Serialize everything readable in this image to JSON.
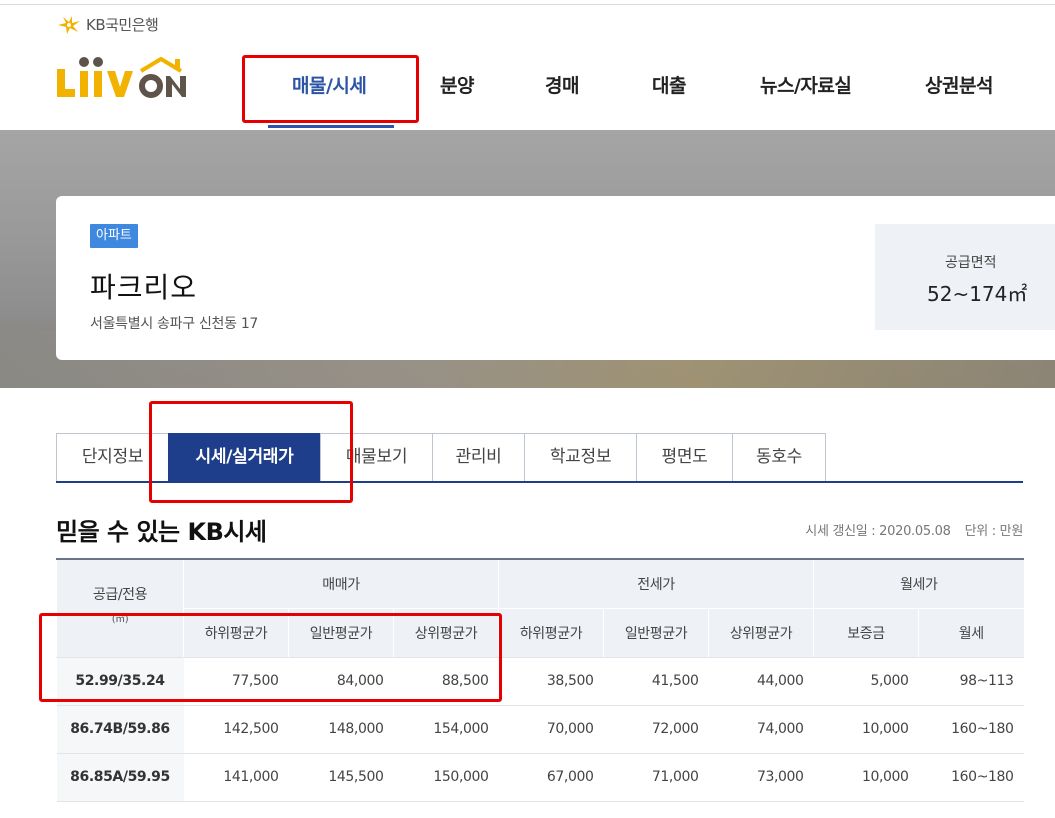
{
  "header": {
    "kb_bank": "KB국민은행",
    "brand": "LiiV ON",
    "nav": [
      {
        "label": "매물/시세",
        "active": true
      },
      {
        "label": "분양"
      },
      {
        "label": "경매"
      },
      {
        "label": "대출"
      },
      {
        "label": "뉴스/자료실"
      },
      {
        "label": "상권분석"
      }
    ]
  },
  "complex": {
    "type_tag": "아파트",
    "name": "파크리오",
    "address": "서울특별시 송파구 신천동 17",
    "area_label": "공급면적",
    "area_value": "52~174㎡"
  },
  "tabs": [
    {
      "label": "단지정보"
    },
    {
      "label": "시세/실거래가",
      "active": true
    },
    {
      "label": "매물보기"
    },
    {
      "label": "관리비"
    },
    {
      "label": "학교정보"
    },
    {
      "label": "평면도"
    },
    {
      "label": "동호수"
    }
  ],
  "section": {
    "title": "믿을 수 있는 KB시세",
    "updated": "시세 갱신일 : 2020.05.08",
    "unit": "단위 : 만원"
  },
  "table": {
    "area_header": "공급/전용",
    "area_unit": "(㎡)",
    "groups": [
      "매매가",
      "전세가",
      "월세가"
    ],
    "subheaders": [
      "하위평균가",
      "일반평균가",
      "상위평균가",
      "하위평균가",
      "일반평균가",
      "상위평균가",
      "보증금",
      "월세"
    ],
    "rows": [
      {
        "area": "52.99/35.24",
        "cells": [
          "77,500",
          "84,000",
          "88,500",
          "38,500",
          "41,500",
          "44,000",
          "5,000",
          "98~113"
        ]
      },
      {
        "area": "86.74B/59.86",
        "cells": [
          "142,500",
          "148,000",
          "154,000",
          "70,000",
          "72,000",
          "74,000",
          "10,000",
          "160~180"
        ]
      },
      {
        "area": "86.85A/59.95",
        "cells": [
          "141,000",
          "145,500",
          "150,000",
          "67,000",
          "71,000",
          "73,000",
          "10,000",
          "160~180"
        ]
      }
    ]
  },
  "colors": {
    "brand_yellow": "#f2b200",
    "nav_active_blue": "#2d55a5",
    "tab_active_navy": "#1e3d8a",
    "tag_blue": "#3f88e0",
    "highlight_red": "#e60000"
  }
}
